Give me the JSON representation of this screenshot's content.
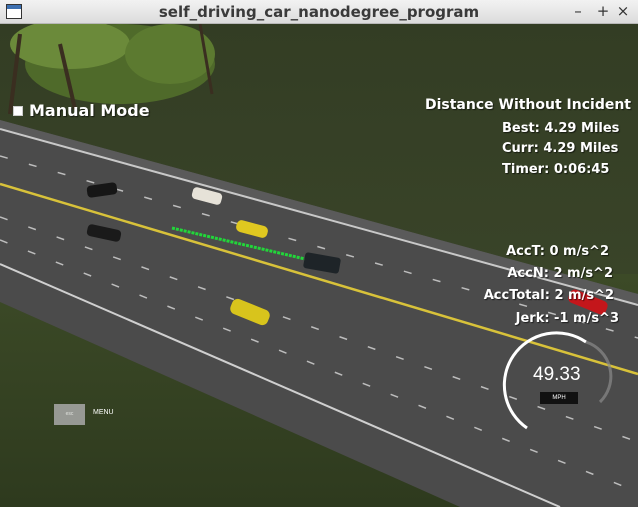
{
  "window": {
    "title": "self_driving_car_nanodegree_program"
  },
  "controls": {
    "minimize": "–",
    "maximize": "+",
    "close": "×"
  },
  "mode": {
    "label": "Manual Mode"
  },
  "distance": {
    "title": "Distance Without Incident",
    "best": "Best: 4.29 Miles",
    "curr": "Curr: 4.29 Miles",
    "timer": "Timer: 0:06:45"
  },
  "accel": {
    "acct": "AccT: 0 m/s^2",
    "accn": "AccN: 2 m/s^2",
    "acctotal": "AccTotal: 2 m/s^2",
    "jerk": "Jerk: -1 m/s^3"
  },
  "menu": {
    "esc": "esc",
    "label": "MENU"
  },
  "speedometer": {
    "value": "49.33",
    "unit": "MPH"
  },
  "colors": {
    "grass": "#3a4528",
    "road": "#4a4a4a",
    "yellow_line": "#d8c23a",
    "path": "#22d63a"
  }
}
